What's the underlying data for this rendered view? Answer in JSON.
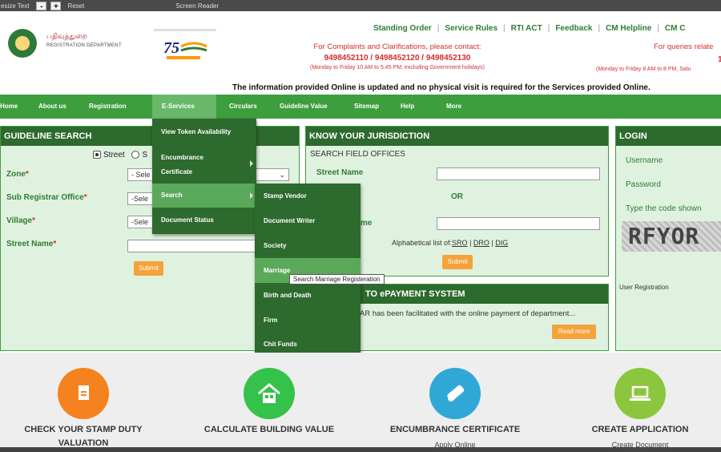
{
  "accessibility": {
    "resize_text": "esize Text",
    "minus": "-",
    "plus": "+",
    "reset": "Reset",
    "screen_reader": "Screen Reader"
  },
  "header": {
    "dept_tamil": "பதிவுத்துறை",
    "dept_english": "REGISTRATION DEPARTMENT",
    "links": [
      "Standing Order",
      "Service Rules",
      "RTI ACT",
      "Feedback",
      "CM Helpline",
      "CM C"
    ],
    "contact": {
      "line1": "For Complaints and Clarifications, please contact:",
      "phones": "9498452110 / 9498452120 / 9498452130",
      "hours": "(Monday to Friday 10 AM to 5.45 PM, excluding Government holidays)"
    },
    "queries": {
      "line1": "For queries relate",
      "phone": "1",
      "hours": "(Monday to Friday 8 AM to 8 PM, Satu"
    },
    "notice": "The information provided Online is updated and no physical visit is required for the Services provided Online."
  },
  "nav": {
    "items": [
      "Home",
      "About us",
      "Registration",
      "E-Services",
      "Circulars",
      "Guideline Value",
      "Sitemap",
      "Help",
      "More"
    ],
    "active": "E-Services"
  },
  "eservices_menu": {
    "items": [
      "View Token Availability",
      "Encumbrance Certificate",
      "Search",
      "Document Status"
    ],
    "encumbrance_line1": "Encumbrance",
    "encumbrance_line2": "Certificate"
  },
  "search_submenu": {
    "items": [
      "Stamp Vendor",
      "Document Writer",
      "Society",
      "Marriage",
      "Birth and Death",
      "Firm",
      "Chit Funds"
    ],
    "highlighted": "Marriage"
  },
  "tooltip": "Search Marriage Registeration",
  "guideline": {
    "title": "GUIDELINE SEARCH",
    "radio_street": "Street",
    "radio_s": "S",
    "zone_label": "Zone",
    "zone_value": "- Sele",
    "sro_label": "Sub Registrar Office",
    "sro_value": "-Sele",
    "village_label": "Village",
    "village_value": "-Sele",
    "street_label": "Street Name",
    "submit": "Submit"
  },
  "jurisdiction": {
    "title": "KNOW YOUR JURISDICTION",
    "subtitle": "SEARCH FIELD OFFICES",
    "street_label": "Street Name",
    "or": "OR",
    "me_label": "me",
    "alpha_label": "Alphabetical list of:",
    "alpha_links": [
      "SRO",
      "DRO",
      "DIG"
    ],
    "submit": "Submit"
  },
  "epayment": {
    "title": "TO ePAYMENT SYSTEM",
    "text": "AR has been facilitated with the online payment of department...",
    "read_more": "Read more"
  },
  "login": {
    "title": "LOGIN",
    "username": "Username",
    "password": "Password",
    "code": "Type the code shown",
    "captcha": "RFYOR",
    "user_registration": "User Registration"
  },
  "services": [
    {
      "title": "CHECK YOUR STAMP DUTY",
      "sub": "VALUATION",
      "color": "#f5821f",
      "icon": "document-icon"
    },
    {
      "title": "CALCULATE BUILDING VALUE",
      "sub": "",
      "color": "#35c24a",
      "icon": "building-icon"
    },
    {
      "title": "ENCUMBRANCE CERTIFICATE",
      "sub": "Apply Online",
      "color": "#2fa8d8",
      "icon": "certificate-icon"
    },
    {
      "title": "CREATE APPLICATION",
      "sub": "Create Document",
      "color": "#8cc63f",
      "icon": "laptop-icon"
    }
  ]
}
